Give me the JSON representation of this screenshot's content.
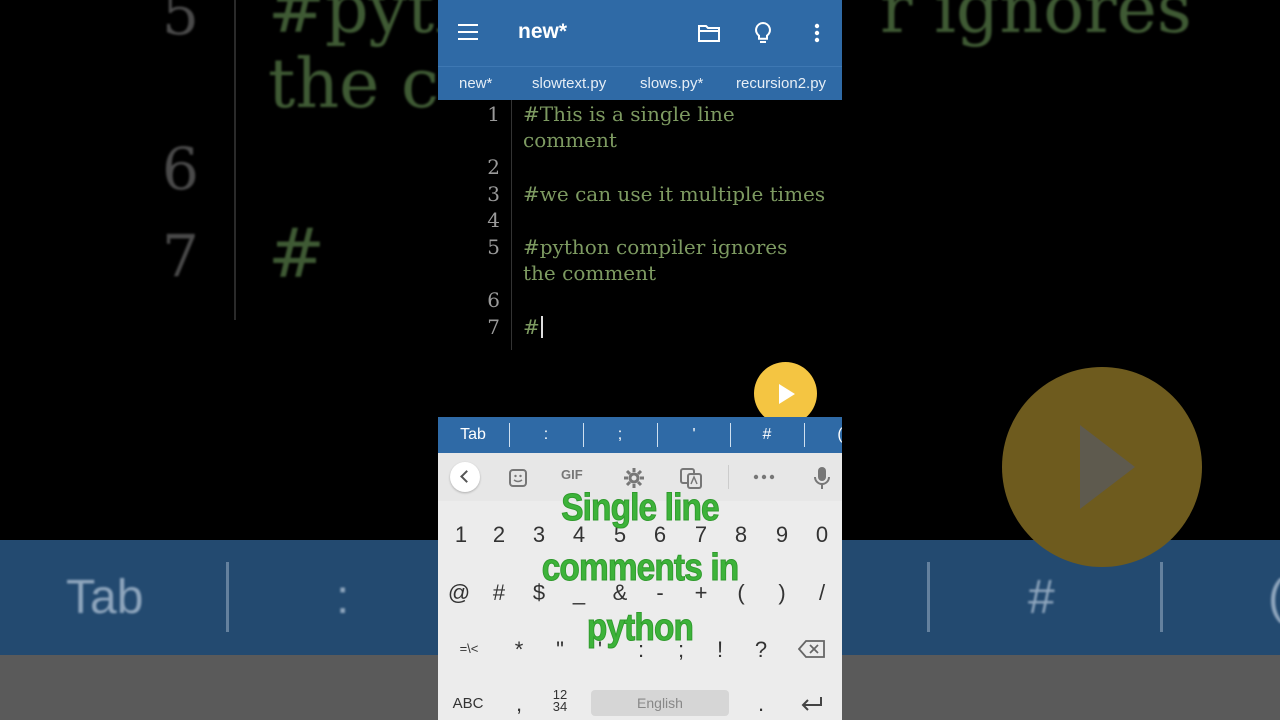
{
  "background": {
    "line_numbers": [
      "5",
      "6",
      "7"
    ],
    "code_fragments": [
      "#pyth",
      "r ignores",
      "the co",
      "#"
    ],
    "symbols": [
      "Tab",
      ":",
      "#",
      "("
    ]
  },
  "appbar": {
    "title": "new*"
  },
  "tabs": [
    "new*",
    "slowtext.py",
    "slows.py*",
    "recursion2.py"
  ],
  "editor": {
    "lines": [
      {
        "num": "1",
        "text": "#This is a single line"
      },
      {
        "num": "",
        "text": "comment"
      },
      {
        "num": "2",
        "text": ""
      },
      {
        "num": "3",
        "text": "#we can use it multiple times"
      },
      {
        "num": "4",
        "text": ""
      },
      {
        "num": "5",
        "text": "#python compiler ignores"
      },
      {
        "num": "",
        "text": "the comment"
      },
      {
        "num": "6",
        "text": ""
      },
      {
        "num": "7",
        "text": "#"
      }
    ]
  },
  "symbol_bar": [
    "Tab",
    ":",
    ";",
    "'",
    "#",
    "("
  ],
  "keyboard": {
    "toolbar": {
      "gif": "GIF"
    },
    "row_numbers": [
      "1",
      "2",
      "3",
      "4",
      "5",
      "6",
      "7",
      "8",
      "9",
      "0"
    ],
    "row_symbols1": [
      "@",
      "#",
      "$",
      "_",
      "&",
      "-",
      "+",
      "(",
      ")",
      "/"
    ],
    "row_symbols2": [
      "=\\<",
      "*",
      "\"",
      "'",
      ":",
      ";",
      "!",
      "?"
    ],
    "bottom": {
      "abc": "ABC",
      "comma": ",",
      "numpad": "12\n34",
      "space": "English",
      "period": "."
    }
  },
  "overlay": {
    "line1": "Single line",
    "line2": "comments in",
    "line3": "python"
  },
  "colors": {
    "appbar": "#2f6aa6",
    "comment": "#7d9a61",
    "fab": "#f4c542",
    "overlay_text": "#3db33a"
  }
}
